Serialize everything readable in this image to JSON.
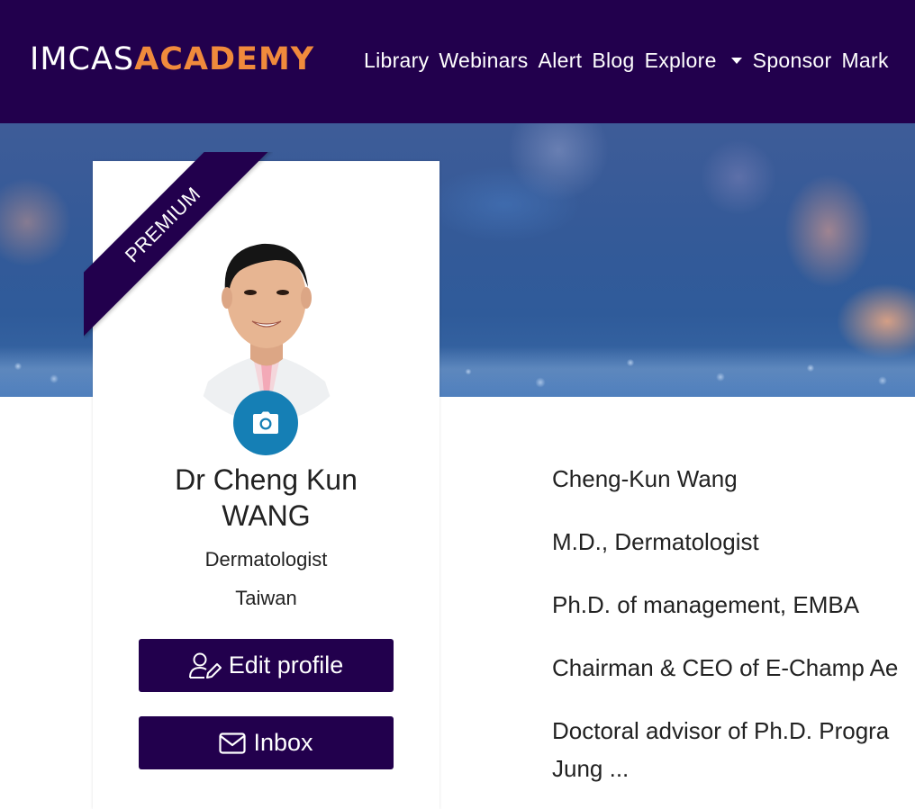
{
  "nav": {
    "logo_part1": "IMCAS",
    "logo_part2": "ACADEMY",
    "links": [
      "Library",
      "Webinars",
      "Alert",
      "Blog",
      "Explore",
      "Sponsor",
      "Mark"
    ]
  },
  "profile": {
    "badge": "PREMIUM",
    "name_line1": "Dr Cheng Kun",
    "name_line2": "WANG",
    "specialty": "Dermatologist",
    "country": "Taiwan",
    "edit_label": "Edit profile",
    "inbox_label": "Inbox",
    "camera_icon": "camera-icon"
  },
  "bio": {
    "lines": [
      "Cheng-Kun Wang",
      "M.D., Dermatologist",
      "Ph.D. of management, EMBA",
      "Chairman & CEO of E-Champ Ae",
      "Doctoral advisor of Ph.D. Progra",
      "Jung ..."
    ]
  },
  "colors": {
    "nav_bg": "#22004d",
    "accent_orange": "#f08a3c",
    "button_bg": "#22004d",
    "camera_bg": "#157fb5"
  }
}
